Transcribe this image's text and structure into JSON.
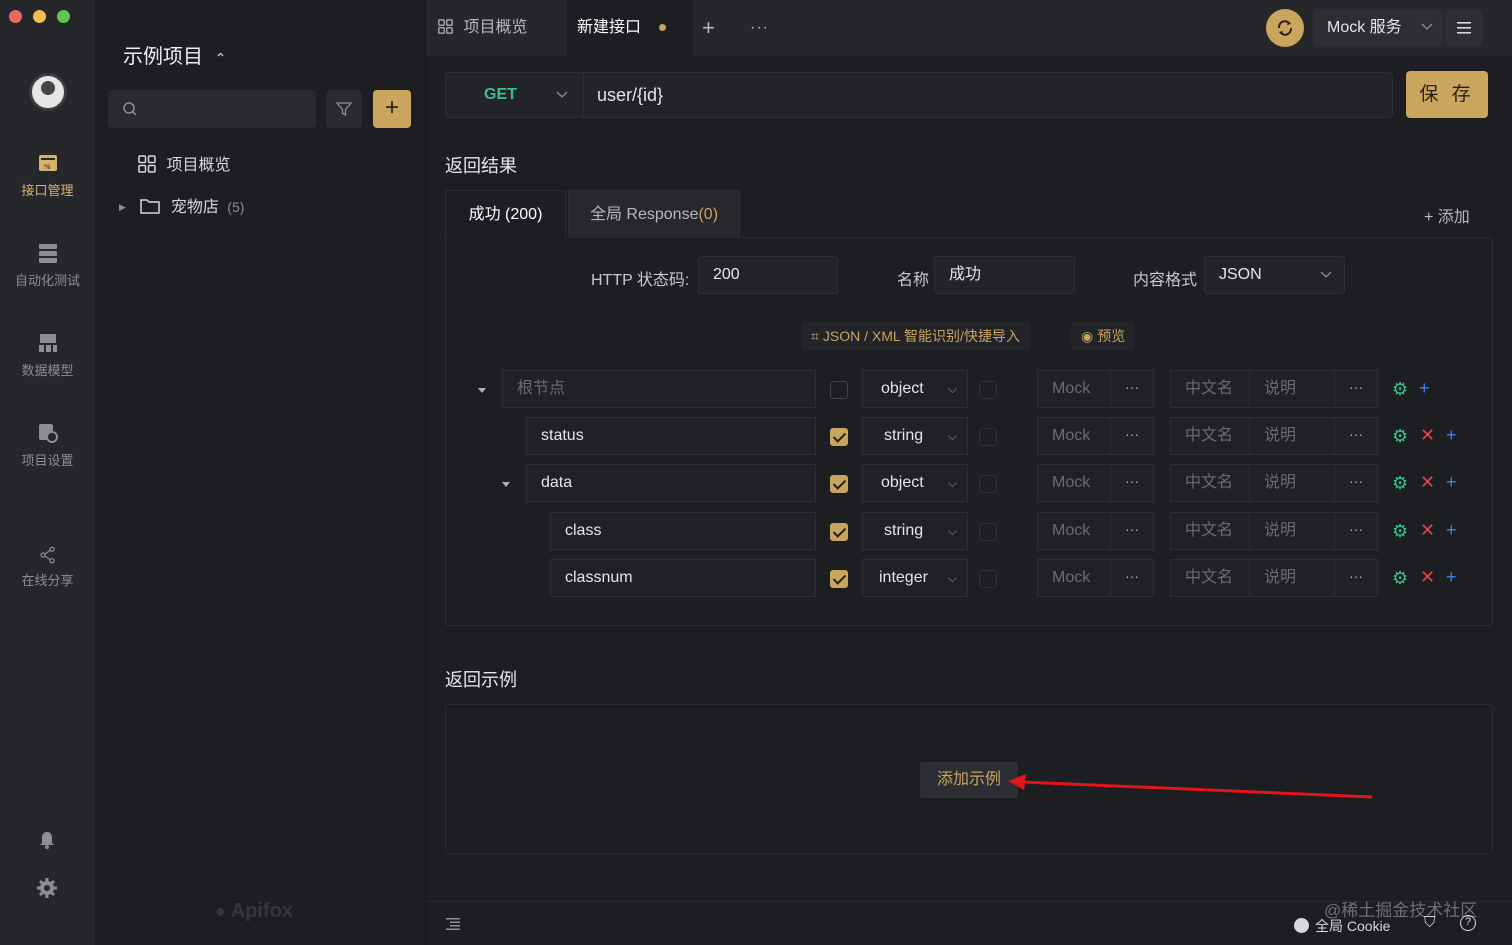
{
  "rail": {
    "items": [
      {
        "label": "接口管理",
        "icon": "api-management-icon"
      },
      {
        "label": "自动化测试",
        "icon": "automation-test-icon"
      },
      {
        "label": "数据模型",
        "icon": "data-model-icon"
      },
      {
        "label": "项目设置",
        "icon": "project-settings-icon"
      },
      {
        "label": "在线分享",
        "icon": "share-icon"
      }
    ]
  },
  "sidebar": {
    "project_title": "示例项目",
    "tree": [
      {
        "label": "项目概览"
      },
      {
        "label": "宠物店",
        "count": "(5)"
      }
    ],
    "watermark": "Apifox"
  },
  "topbar": {
    "tabs": [
      {
        "label": "项目概览"
      },
      {
        "label": "新建接口"
      }
    ],
    "env": "Mock 服务"
  },
  "request": {
    "method": "GET",
    "url": "user/{id}",
    "save_label": "保 存"
  },
  "response": {
    "section_title": "返回结果",
    "tabs": [
      {
        "label": "成功 (200)"
      },
      {
        "label": "全局 Response",
        "count": "(0)"
      }
    ],
    "add_label": "+ 添加",
    "status_label": "HTTP 状态码:",
    "status_value": "200",
    "name_label": "名称",
    "name_value": "成功",
    "format_label": "内容格式",
    "format_value": "JSON",
    "import_label": "JSON / XML 智能识别/快捷导入",
    "preview_label": "预览",
    "rows": [
      {
        "name": "根节点",
        "type": "object",
        "mock": "Mock",
        "cn": "中文名",
        "desc": "说明"
      },
      {
        "name": "status",
        "type": "string",
        "mock": "Mock",
        "cn": "中文名",
        "desc": "说明"
      },
      {
        "name": "data",
        "type": "object",
        "mock": "Mock",
        "cn": "中文名",
        "desc": "说明"
      },
      {
        "name": "class",
        "type": "string",
        "mock": "Mock",
        "cn": "中文名",
        "desc": "说明"
      },
      {
        "name": "classnum",
        "type": "integer",
        "mock": "Mock",
        "cn": "中文名",
        "desc": "说明"
      }
    ]
  },
  "example": {
    "section_title": "返回示例",
    "add_label": "添加示例"
  },
  "statusbar": {
    "cookie_label": "全局 Cookie",
    "watermark": "@稀土掘金技术社区"
  },
  "colors": {
    "accent": "#c9a55e",
    "get": "#37c28e",
    "delete": "#e0464c",
    "add": "#3b82f6",
    "arrow": "#e0161b"
  }
}
